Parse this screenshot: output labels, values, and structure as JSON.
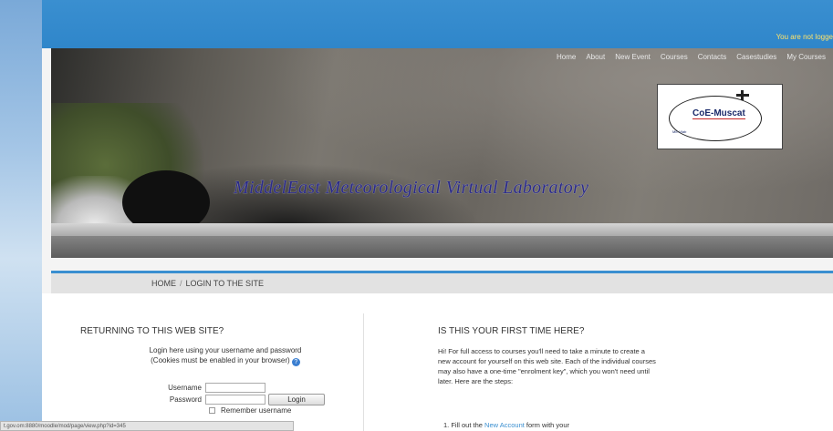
{
  "header": {
    "status_text": "You are not logge"
  },
  "nav": {
    "items": [
      "Home",
      "About",
      "New Event",
      "Courses",
      "Contacts",
      "Casestudies",
      "My Courses"
    ]
  },
  "logo": {
    "name": "CoE-Muscat",
    "sub": "ME-Vlab"
  },
  "site_title": "MiddelEast Meteorological Virtual Laboratory",
  "breadcrumb": {
    "home": "HOME",
    "sep": "/",
    "current": "LOGIN TO THE SITE"
  },
  "login": {
    "heading": "RETURNING TO THIS WEB SITE?",
    "desc_line1": "Login here using your username and password",
    "desc_line2": "(Cookies must be enabled in your browser)",
    "username_label": "Username",
    "password_label": "Password",
    "login_button": "Login",
    "remember_label": "Remember username"
  },
  "signup": {
    "heading": "IS THIS YOUR FIRST TIME HERE?",
    "intro": "Hi! For full access to courses you'll need to take a minute to create a new account for yourself on this web site. Each of the individual courses may also have a one-time \"enrolment key\", which you won't need until later. Here are the steps:",
    "step_prefix": "1.  Fill out the",
    "step_link": "New Account",
    "step_suffix": "form with your"
  },
  "statusbar": {
    "url": "t.gov.om:8880/moodle/mod/page/view.php?id=345"
  },
  "colors": {
    "accent": "#3a8fd0",
    "link": "#3a8fd0",
    "title": "#2a2a8a"
  }
}
